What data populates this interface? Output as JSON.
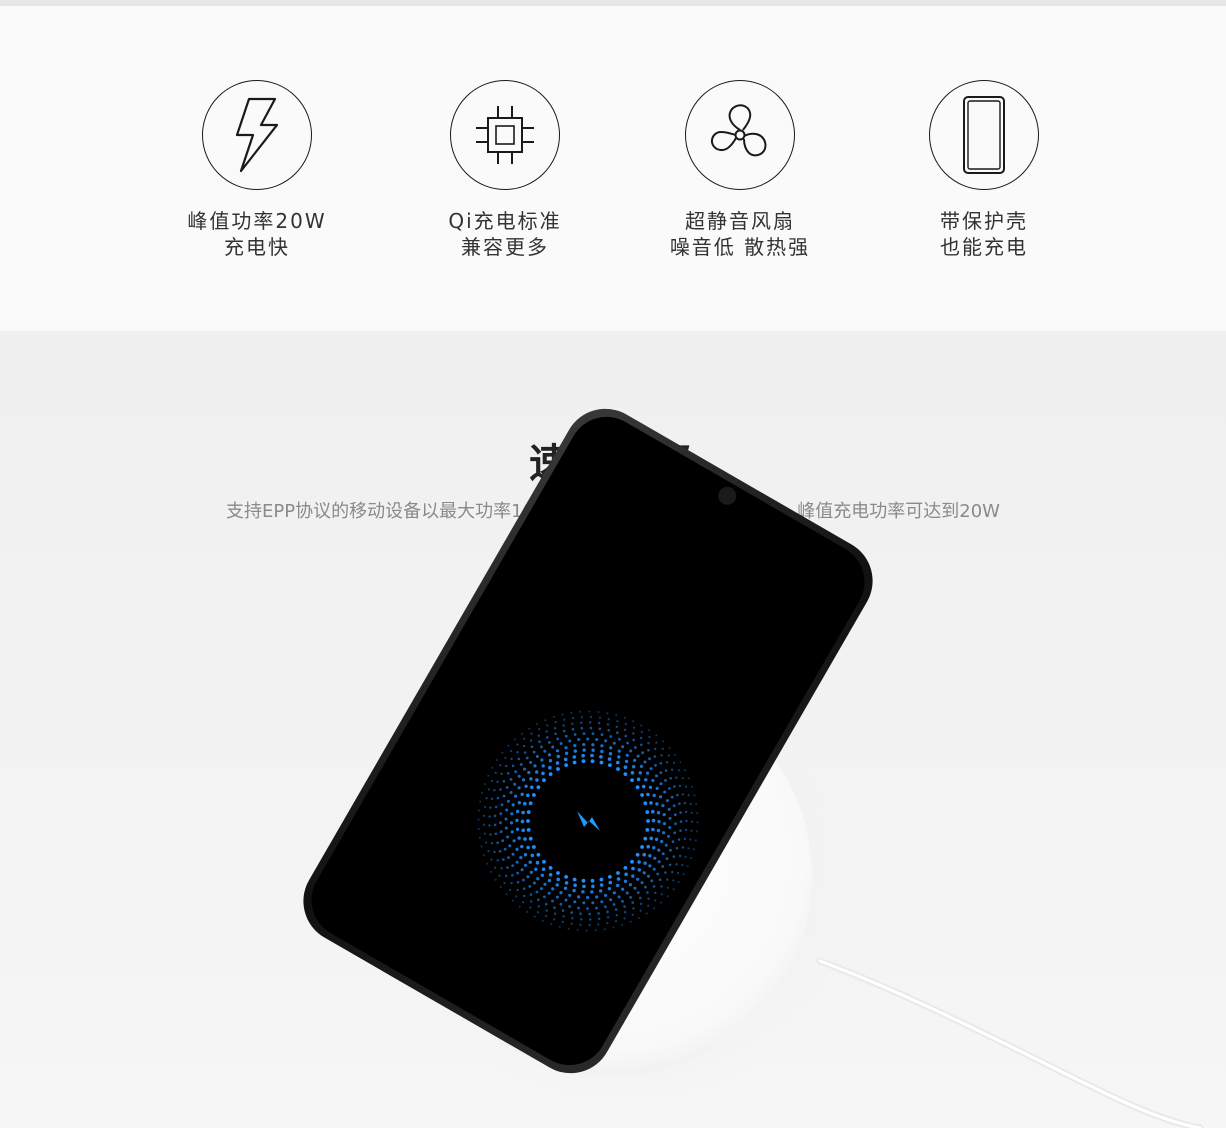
{
  "features": [
    {
      "icon": "lightning-icon",
      "line1": "峰值功率20W",
      "line2": "充电快"
    },
    {
      "icon": "chip-icon",
      "line1": "Qi充电标准",
      "line2": "兼容更多"
    },
    {
      "icon": "fan-icon",
      "line1": "超静音风扇",
      "line2": "噪音低 散热强"
    },
    {
      "icon": "phone-case-icon",
      "line1": "带保护壳",
      "line2": "也能充电"
    }
  ],
  "speed_section": {
    "title": "速度升级",
    "description": "支持EPP协议的移动设备以最大功率10W充电。搭配小米9充电更快捷，峰值充电功率可达到20W"
  },
  "colors": {
    "accent_blue": "#1f8fff",
    "phone_body": "#0c0c0c",
    "charger_pad": "#fbfbfb"
  }
}
